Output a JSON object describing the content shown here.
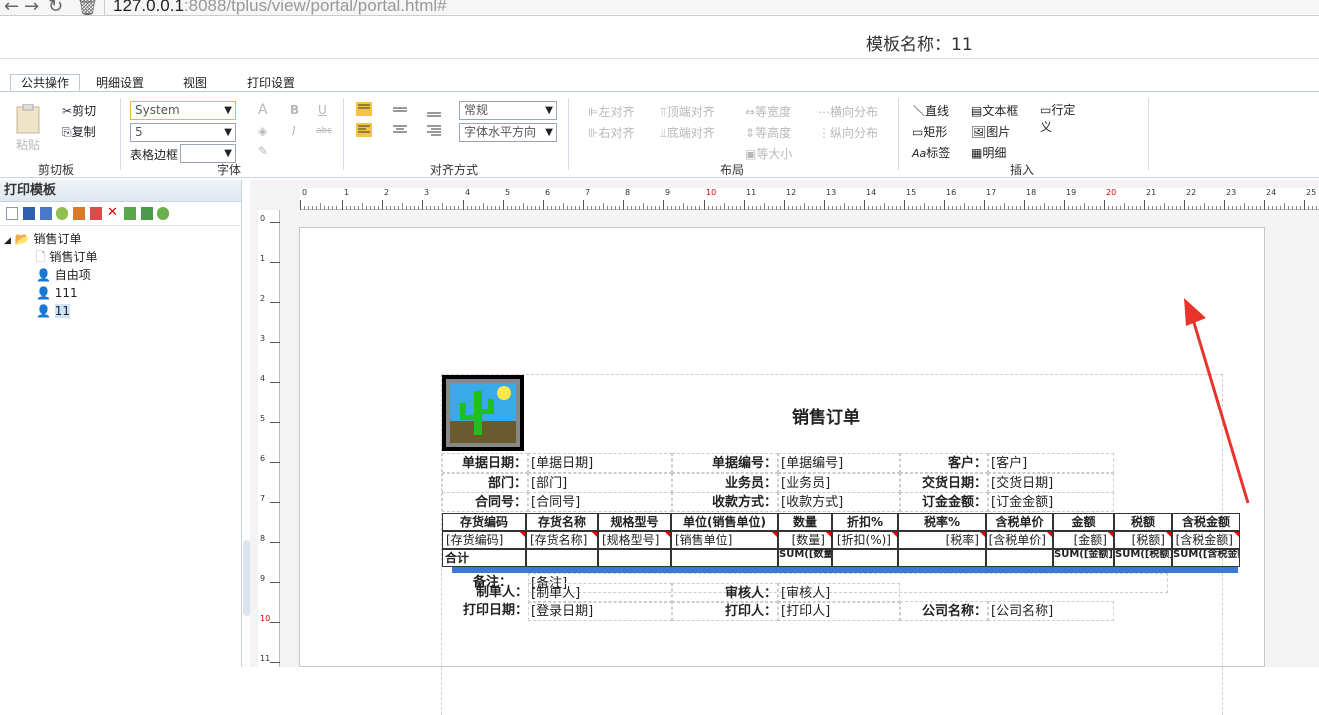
{
  "browser": {
    "url": "127.0.0.1:8088/tplus/view/portal/portal.html#",
    "url_host": "127.0.0.1",
    "url_rest": ":8088/tplus/view/portal/portal.html#"
  },
  "template_title": "模板名称：11",
  "tabs": [
    "公共操作",
    "明细设置",
    "视图",
    "打印设置"
  ],
  "ribbon": {
    "clipboard": {
      "paste": "粘贴",
      "cut": "剪切",
      "copy": "复制",
      "label": "剪切板"
    },
    "font": {
      "font_name": "System",
      "font_size": "5",
      "table_border": "表格边框",
      "label": "字体",
      "bold": "B",
      "italic": "I",
      "underline": "U",
      "strike": "abc"
    },
    "align": {
      "style_select": "常规",
      "direction_select": "字体水平方向",
      "label": "对齐方式"
    },
    "layout": {
      "left_align": "左对齐",
      "top_align": "顶端对齐",
      "equal_width": "等宽度",
      "h_distribute": "横向分布",
      "right_align": "右对齐",
      "bottom_align": "底端对齐",
      "equal_height": "等高度",
      "v_distribute": "纵向分布",
      "equal_size": "等大小",
      "label": "布局"
    },
    "insert": {
      "line": "直线",
      "textbox": "文本框",
      "row_define": "行定义",
      "rect": "矩形",
      "image": "图片",
      "label_item": "标签",
      "detail": "明细",
      "label": "插入"
    }
  },
  "left_panel": {
    "title": "打印模板",
    "tree": {
      "root": "销售订单",
      "items": [
        "销售订单",
        "自由项",
        "111",
        "11"
      ]
    }
  },
  "ruler": {
    "h": [
      "0",
      "1",
      "2",
      "3",
      "4",
      "5",
      "6",
      "7",
      "8",
      "9",
      "10",
      "11",
      "12",
      "13",
      "14",
      "15",
      "16",
      "17",
      "18",
      "19",
      "20",
      "21",
      "22",
      "23",
      "24",
      "25"
    ],
    "v": [
      "0",
      "1",
      "2",
      "3",
      "4",
      "5",
      "6",
      "7",
      "8",
      "9",
      "10",
      "11"
    ]
  },
  "report": {
    "title": "销售订单",
    "header_fields": [
      {
        "label": "单据日期：",
        "value": "[单据日期]",
        "label2": "单据编号：",
        "value2": "[单据编号]",
        "label3": "客户：",
        "value3": "[客户]"
      },
      {
        "label": "部门：",
        "value": "[部门]",
        "label2": "业务员：",
        "value2": "[业务员]",
        "label3": "交货日期：",
        "value3": "[交货日期]"
      },
      {
        "label": "合同号：",
        "value": "[合同号]",
        "label2": "收款方式：",
        "value2": "[收款方式]",
        "label3": "订金金额：",
        "value3": "[订金金额]"
      }
    ],
    "columns": [
      "存货编码",
      "存货名称",
      "规格型号",
      "单位(销售单位)",
      "数量",
      "折扣%",
      "税率%",
      "含税单价",
      "金额",
      "税额",
      "含税金额"
    ],
    "detail_row": [
      "[存货编码]",
      "[存货名称]",
      "[规格型号]",
      "[销售单位]",
      "[数量]",
      "[折扣(%)]",
      "[税率]",
      "[含税单价]",
      "[金额]",
      "[税额]",
      "[含税金额]"
    ],
    "sum_row": {
      "label": "合计",
      "qty": "SUM([数量])",
      "amount": "SUM([金额])",
      "tax": "SUM([税额])",
      "total": "SUM([含税金额])"
    },
    "footer_fields": [
      {
        "label": "备注：",
        "value": "[备注]"
      },
      {
        "label": "制单人：",
        "value": "[制单人]",
        "label2": "审核人：",
        "value2": "[审核人]"
      },
      {
        "label": "打印日期：",
        "value": "[登录日期]",
        "label2": "打印人：",
        "value2": "[打印人]",
        "label3": "公司名称：",
        "value3": "[公司名称]"
      }
    ]
  }
}
